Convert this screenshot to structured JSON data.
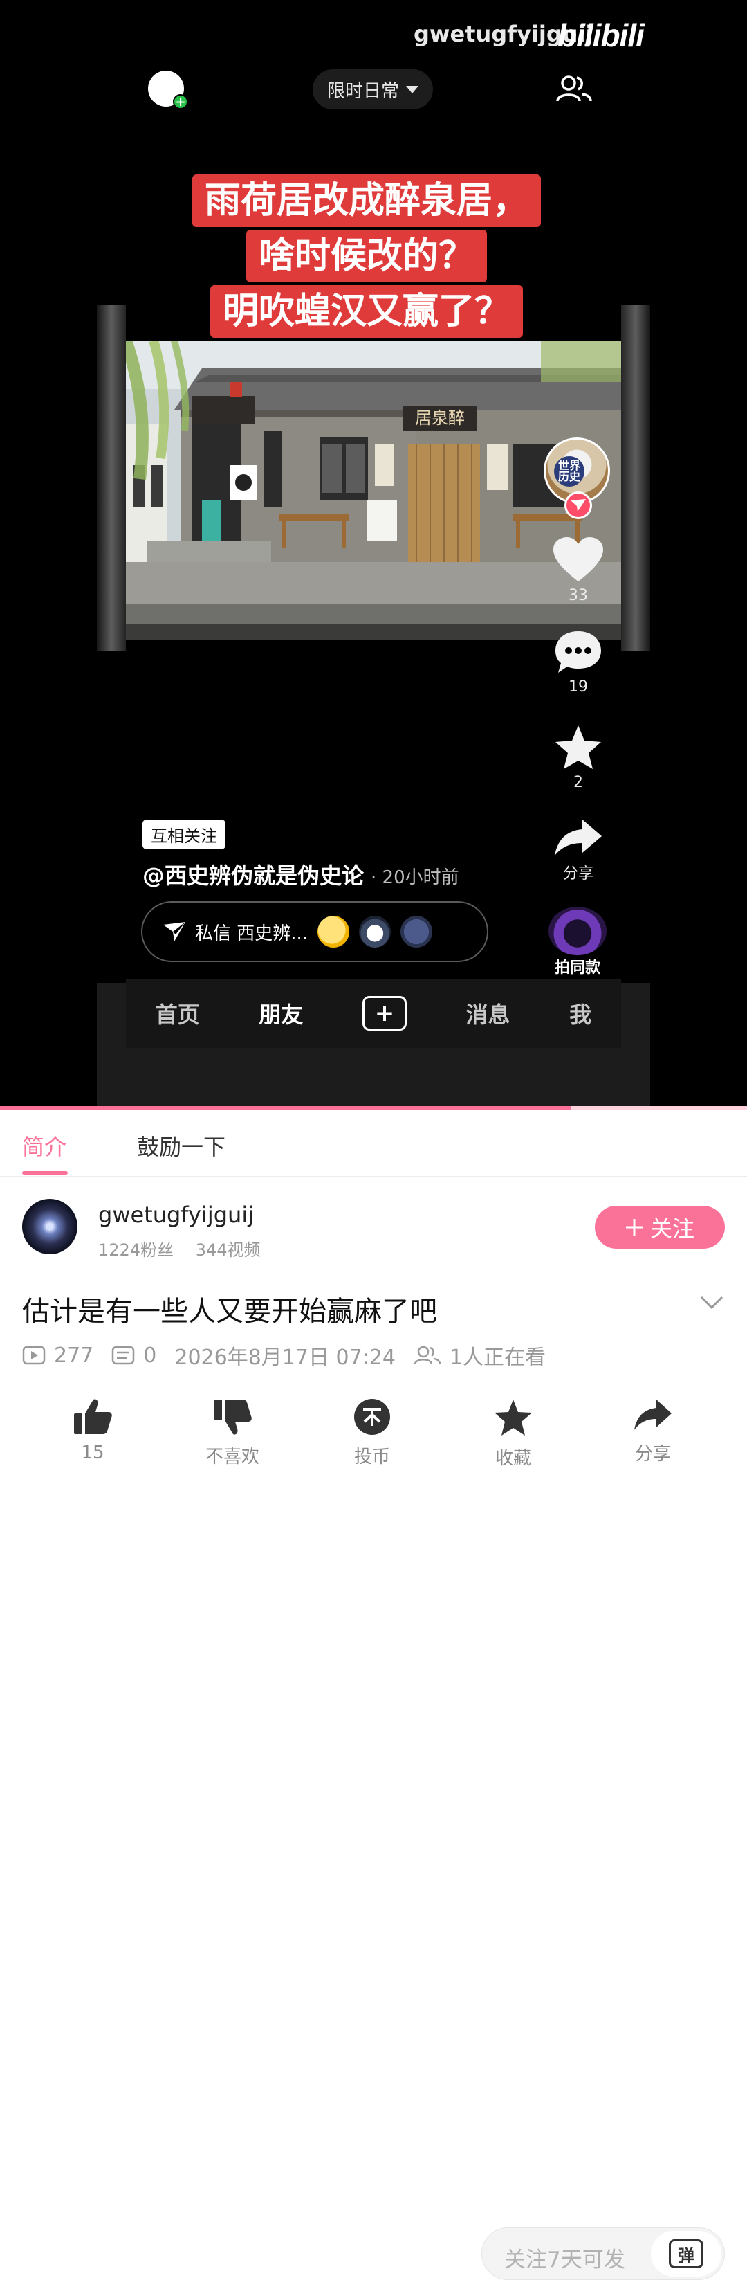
{
  "watermark": {
    "user": "gwetugfyijguij",
    "logo": "bilibili"
  },
  "player": {
    "top_pill": "限时日常",
    "title_lines": [
      "雨荷居改成醉泉居，",
      "啥时候改的？",
      "明吹蝗汉又赢了？"
    ],
    "sign_text": "居泉醉",
    "creator_badge": "世界历史",
    "actions": {
      "like_count": "33",
      "comment_count": "19",
      "fav_count": "2",
      "share_label": "分享",
      "same_style_label": "拍同款"
    },
    "mutual_badge": "互相关注",
    "handle": "@西史辨伪就是伪史论",
    "time_ago": "· 20小时前",
    "dm_text": "私信 西史辨...",
    "nav": [
      "首页",
      "朋友",
      "+",
      "消息",
      "我"
    ],
    "nav_active_index": 1,
    "progress": 0.765
  },
  "tabs": {
    "intro": "简介",
    "encourage": "鼓励一下",
    "danmaku_placeholder": "关注7天可发",
    "danmaku_btn": "弹"
  },
  "uploader": {
    "name": "gwetugfyijguij",
    "fans": "1224粉丝",
    "videos": "344视频",
    "follow_label": "关注"
  },
  "video": {
    "title": "估计是有一些人又要开始赢麻了吧",
    "plays": "277",
    "danmaku": "0",
    "date": "2026年8月17日 07:24",
    "watching": "1人正在看"
  },
  "action_bar": {
    "like": "15",
    "dislike": "不喜欢",
    "coin": "投币",
    "fav": "收藏",
    "share": "分享"
  },
  "colors": {
    "accent": "#fb7299",
    "title_red": "#e03b3b"
  }
}
